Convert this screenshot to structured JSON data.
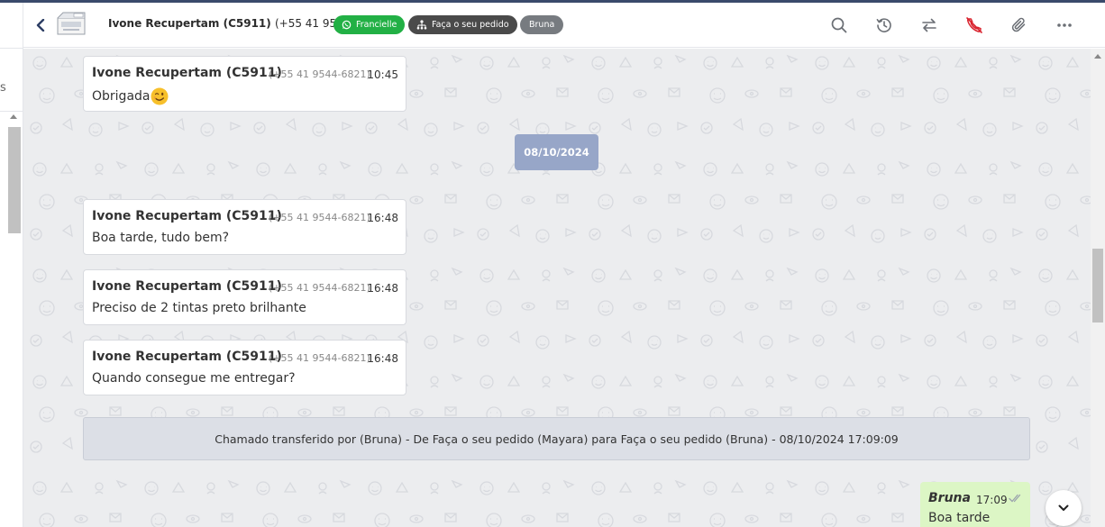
{
  "sidebar": {
    "stub_text": "s"
  },
  "header": {
    "contact_name": "Ivone Recupertam (C5911)",
    "contact_phone": "(+55 41 9544-6821)",
    "badges": {
      "channel_label": "Francielle",
      "department_label": "Faça o seu pedido",
      "agent_label": "Bruna"
    },
    "icons": [
      "chevron-left-icon",
      "search-icon",
      "history-icon",
      "transfer-icon",
      "end-call-icon",
      "paperclip-icon",
      "more-icon"
    ]
  },
  "chat": {
    "incoming": [
      {
        "sender": "Ivone Recupertam (C5911)",
        "phone": "(+55 41 9544-6821)",
        "time": "10:45",
        "text": "Obrigada",
        "emoji": "wink-emoji"
      },
      {
        "sender": "Ivone Recupertam (C5911)",
        "phone": "(+55 41 9544-6821)",
        "time": "16:48",
        "text": "Boa tarde, tudo bem?"
      },
      {
        "sender": "Ivone Recupertam (C5911)",
        "phone": "(+55 41 9544-6821)",
        "time": "16:48",
        "text": "Preciso de 2 tintas preto brilhante"
      },
      {
        "sender": "Ivone Recupertam (C5911)",
        "phone": "(+55 41 9544-6821)",
        "time": "16:48",
        "text": "Quando consegue me entregar?"
      }
    ],
    "date_separator": "08/10/2024",
    "system_message": "Chamado transferido por (Bruna) - De Faça o seu pedido (Mayara) para Faça o seu pedido (Bruna) - 08/10/2024 17:09:09",
    "outgoing": {
      "sender": "Bruna",
      "time": "17:09",
      "text": "Boa tarde"
    }
  },
  "colors": {
    "whatsapp_green": "#22b045",
    "date_chip": "#97a6c8",
    "outgoing_bubble": "#dcf6c5",
    "chat_background": "#ecedef",
    "end_call_red": "#d9232e"
  }
}
